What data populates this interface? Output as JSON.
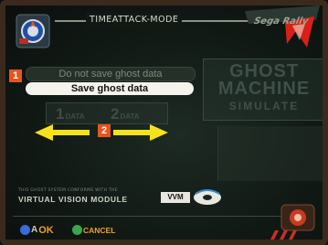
{
  "header": {
    "mode_title": "TIMEATTACK-MODE",
    "brand": "Sega Rally"
  },
  "ghost_panel": {
    "line1": "GHOST",
    "line2": "MACHINE",
    "line3": "SIMULATE"
  },
  "options": {
    "step1_badge": "1",
    "items": [
      {
        "label": "Do not save ghost data",
        "selected": false
      },
      {
        "label": "Save ghost data",
        "selected": true
      }
    ]
  },
  "data_slots": {
    "step2_badge": "2",
    "slots": [
      {
        "number": "1",
        "word": "DATA"
      },
      {
        "number": "2",
        "word": "DATA"
      }
    ]
  },
  "vvm": {
    "small_text": "THIS GHOST SYSTEM CONFORMS WITH THE",
    "main_text": "VIRTUAL VISION MODULE",
    "badge": "VVM"
  },
  "footer": {
    "ok": {
      "letter": "A",
      "label": "OK"
    },
    "cancel": {
      "letter": "B",
      "label": "CANCEL"
    }
  },
  "colors": {
    "accent_orange": "#e8541c",
    "arrow_yellow": "#f5e21a",
    "button_label": "#f0a020",
    "selected_bg": "#f4f3ec"
  },
  "icons": [
    "emblem-icon",
    "left-arrow-icon",
    "right-arrow-icon",
    "a-button-icon",
    "b-button-icon",
    "disc-icon",
    "corner-emblem-icon"
  ]
}
